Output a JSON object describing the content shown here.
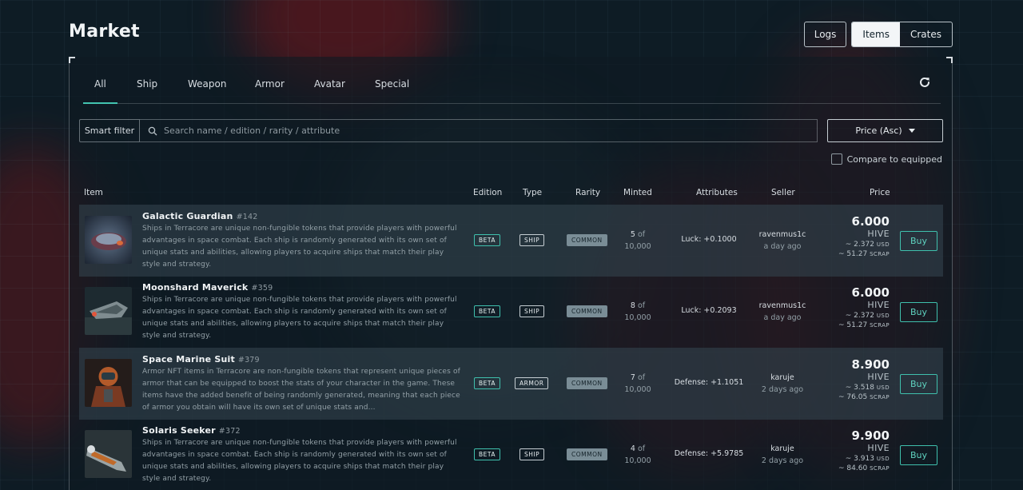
{
  "header": {
    "title": "Market",
    "logs_label": "Logs",
    "items_label": "Items",
    "crates_label": "Crates"
  },
  "tabs": [
    {
      "label": "All",
      "active": true
    },
    {
      "label": "Ship"
    },
    {
      "label": "Weapon"
    },
    {
      "label": "Armor"
    },
    {
      "label": "Avatar"
    },
    {
      "label": "Special"
    }
  ],
  "icons": {
    "refresh": "refresh-icon",
    "search": "search-icon",
    "sort": "caret-down-icon"
  },
  "filter": {
    "smart_label": "Smart filter",
    "search_placeholder": "Search name / edition / rarity / attribute",
    "sort_label": "Price (Asc)",
    "compare_label": "Compare to equipped"
  },
  "columns": [
    "Item",
    "Edition",
    "Type",
    "Rarity",
    "Minted",
    "Attributes",
    "Seller",
    "Price"
  ],
  "colors": {
    "accent": "#3fc0ad",
    "rarity": "#7a8d96"
  },
  "rows": [
    {
      "name": "Galactic Guardian",
      "edition_no": "#142",
      "desc": "Ships in Terracore are unique non-fungible tokens that provide players with powerful advantages in space combat. Each ship is randomly generated with its own set of unique stats and abilities, allowing players to acquire ships that match their play style and strategy.",
      "edition": "BETA",
      "type": "SHIP",
      "rarity": "COMMON",
      "minted_n": "5",
      "minted_of": "of",
      "minted_total": "10,000",
      "attr": "Luck: +0.1000",
      "seller": "ravenmus1c",
      "when": "a day ago",
      "price": "6.000",
      "currency": "HIVE",
      "usd": "~ 2.372",
      "usd_unit": "USD",
      "scrap": "~ 51.27",
      "scrap_unit": "SCRAP",
      "buy": "Buy"
    },
    {
      "name": "Moonshard Maverick",
      "edition_no": "#359",
      "desc": "Ships in Terracore are unique non-fungible tokens that provide players with powerful advantages in space combat. Each ship is randomly generated with its own set of unique stats and abilities, allowing players to acquire ships that match their play style and strategy.",
      "edition": "BETA",
      "type": "SHIP",
      "rarity": "COMMON",
      "minted_n": "8",
      "minted_of": "of",
      "minted_total": "10,000",
      "attr": "Luck: +0.2093",
      "seller": "ravenmus1c",
      "when": "a day ago",
      "price": "6.000",
      "currency": "HIVE",
      "usd": "~ 2.372",
      "usd_unit": "USD",
      "scrap": "~ 51.27",
      "scrap_unit": "SCRAP",
      "buy": "Buy"
    },
    {
      "name": "Space Marine Suit",
      "edition_no": "#379",
      "desc": "Armor NFT items in Terracore are non-fungible tokens that represent unique pieces of armor that can be equipped to boost the stats of your character in the game. These items have the added benefit of being randomly generated, meaning that each piece of armor you obtain will have its own set of unique stats and...",
      "edition": "BETA",
      "type": "ARMOR",
      "rarity": "COMMON",
      "minted_n": "7",
      "minted_of": "of",
      "minted_total": "10,000",
      "attr": "Defense: +1.1051",
      "seller": "karuje",
      "when": "2 days ago",
      "price": "8.900",
      "currency": "HIVE",
      "usd": "~ 3.518",
      "usd_unit": "USD",
      "scrap": "~ 76.05",
      "scrap_unit": "SCRAP",
      "buy": "Buy"
    },
    {
      "name": "Solaris Seeker",
      "edition_no": "#372",
      "desc": "Ships in Terracore are unique non-fungible tokens that provide players with powerful advantages in space combat. Each ship is randomly generated with its own set of unique stats and abilities, allowing players to acquire ships that match their play style and strategy.",
      "edition": "BETA",
      "type": "SHIP",
      "rarity": "COMMON",
      "minted_n": "4",
      "minted_of": "of",
      "minted_total": "10,000",
      "attr": "Defense: +5.9785",
      "seller": "karuje",
      "when": "2 days ago",
      "price": "9.900",
      "currency": "HIVE",
      "usd": "~ 3.913",
      "usd_unit": "USD",
      "scrap": "~ 84.60",
      "scrap_unit": "SCRAP",
      "buy": "Buy"
    }
  ]
}
